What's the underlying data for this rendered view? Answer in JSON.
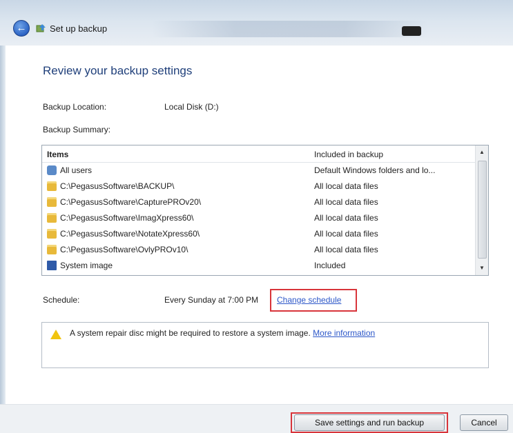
{
  "window": {
    "title": "Set up backup"
  },
  "page": {
    "heading": "Review your backup settings"
  },
  "backup_location": {
    "label": "Backup Location:",
    "value": "Local Disk (D:)"
  },
  "backup_summary": {
    "label": "Backup Summary:"
  },
  "list": {
    "columns": [
      "Items",
      "Included in backup"
    ],
    "rows": [
      {
        "name": "All users",
        "included": "Default Windows folders and lo...",
        "icon": "users-icon"
      },
      {
        "name": "C:\\PegasusSoftware\\BACKUP\\",
        "included": "All local data files",
        "icon": "folder-icon"
      },
      {
        "name": "C:\\PegasusSoftware\\CapturePROv20\\",
        "included": "All local data files",
        "icon": "folder-icon"
      },
      {
        "name": "C:\\PegasusSoftware\\ImagXpress60\\",
        "included": "All local data files",
        "icon": "folder-icon"
      },
      {
        "name": "C:\\PegasusSoftware\\NotateXpress60\\",
        "included": "All local data files",
        "icon": "folder-icon"
      },
      {
        "name": "C:\\PegasusSoftware\\OvlyPROv10\\",
        "included": "All local data files",
        "icon": "folder-icon"
      },
      {
        "name": "System image",
        "included": "Included",
        "icon": "system-image-icon"
      }
    ]
  },
  "schedule": {
    "label": "Schedule:",
    "value": "Every Sunday at 7:00 PM",
    "link": "Change schedule"
  },
  "warning": {
    "text": "A system repair disc might be required to restore a system image.",
    "link": "More information"
  },
  "footer": {
    "save_label": "Save settings and run backup",
    "cancel_label": "Cancel"
  },
  "colors": {
    "heading": "#1f3f7a",
    "link": "#2b56c8",
    "highlight": "#d8343a"
  }
}
